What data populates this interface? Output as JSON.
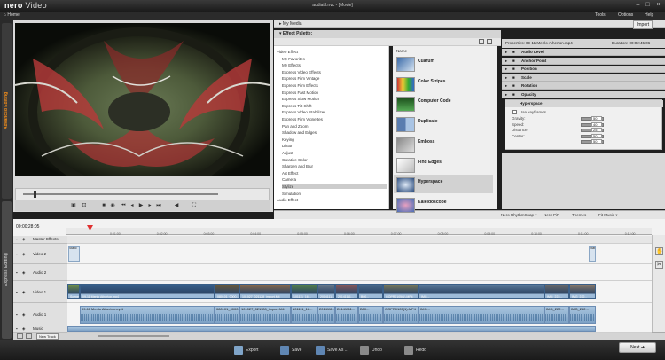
{
  "window": {
    "app_logo_brand": "nero",
    "app_logo_product": "Video",
    "title": "audiatil.nvc - [Movie]",
    "home_label": "Home",
    "menu": [
      "Tools",
      "Options",
      "Help"
    ]
  },
  "left_tabs": {
    "advanced": "Advanced Editing",
    "express": "Express Editing"
  },
  "media": {
    "my_media_label": "My Media",
    "import_label": "Import"
  },
  "effect_palette": {
    "title": "Effect Palette:",
    "tree": [
      "Video Effect",
      "My Favorites",
      "My Effects",
      "Express Video Effects",
      "Express Film Vintage",
      "Express Film Effects",
      "Express Fast Motion",
      "Express Slow Motion",
      "Express Tilt Shift",
      "Express Video Stabilizer",
      "Express Film Vignettes",
      "Pan and Zoom",
      "Shadow and Edges",
      "Keying",
      "Distort",
      "Adjust",
      "Creative Color",
      "Sharpen and Blur",
      "Art Effect",
      "Camera",
      "Stylize",
      "Simulation",
      "Audio Effect"
    ],
    "selected": "Stylize",
    "list_header": "Name",
    "effects": [
      "Cuarum",
      "Color Stripes",
      "Computer Code",
      "Duplicate",
      "Emboss",
      "Find Edges",
      "Hyperspace",
      "Kaleidoscope"
    ],
    "selected_effect": "Hyperspace"
  },
  "properties": {
    "header": "Properties: 09-11 Menlo Atherton.mp4",
    "duration": "Duration: 00:02:45:06",
    "groups": [
      "Audio Level",
      "Anchor Point",
      "Position",
      "Scale",
      "Rotation",
      "Opacity"
    ],
    "effect_name": "Hyperspace",
    "use_keyframes": "Use keyframes",
    "params": [
      {
        "label": "Gravity:",
        "value": "50"
      },
      {
        "label": "Speed:",
        "value": "40"
      },
      {
        "label": "Distance:",
        "value": "25"
      },
      {
        "label": "Center:",
        "value": "50"
      },
      {
        "label": "",
        "value": "50"
      }
    ]
  },
  "timeline_toolbar": [
    "Nero RhythmSnap",
    "Nero PiP",
    "Themes",
    "Fit Music"
  ],
  "timeline": {
    "timecode": "00:00:28:05",
    "ruler_ticks": [
      "0:01:00",
      "0:02:00",
      "0:03:00",
      "0:04:00",
      "0:05:00",
      "0:06:00",
      "0:07:00",
      "0:08:00",
      "0:09:00",
      "0:10:00",
      "0:11:00",
      "0:12:00"
    ],
    "tracks": [
      "Master Effects",
      "Video 2",
      "Audio 2",
      "Video 1",
      "Audio 1",
      "Music"
    ],
    "new_track": "New Track",
    "clips": {
      "still_label": "Static",
      "video1_clips": [
        "Scene",
        "09-11 Menlo Atherton.mp4",
        "080101_0000...",
        "101027_021128_import.M4",
        "101111_16...",
        "2014111...",
        "20141111...",
        "B00...",
        "GOPR0105(1).MP4",
        "IMG...",
        "IMG_222...",
        "IMG_222..."
      ],
      "audio1_clips": [
        "09-11 Menlo Atherton.mp4",
        "080101_0000...",
        "101027_021128_import.M4",
        "101111_16...",
        "2014111...",
        "20141111...",
        "B00...",
        "GOPR0105(1).MP4",
        "IMG...",
        "IMG_222...",
        "IMG_222..."
      ]
    }
  },
  "footer": {
    "export": "Export",
    "save": "Save",
    "save_as": "Save As ...",
    "undo": "Undo",
    "redo": "Redo",
    "next": "Next"
  }
}
